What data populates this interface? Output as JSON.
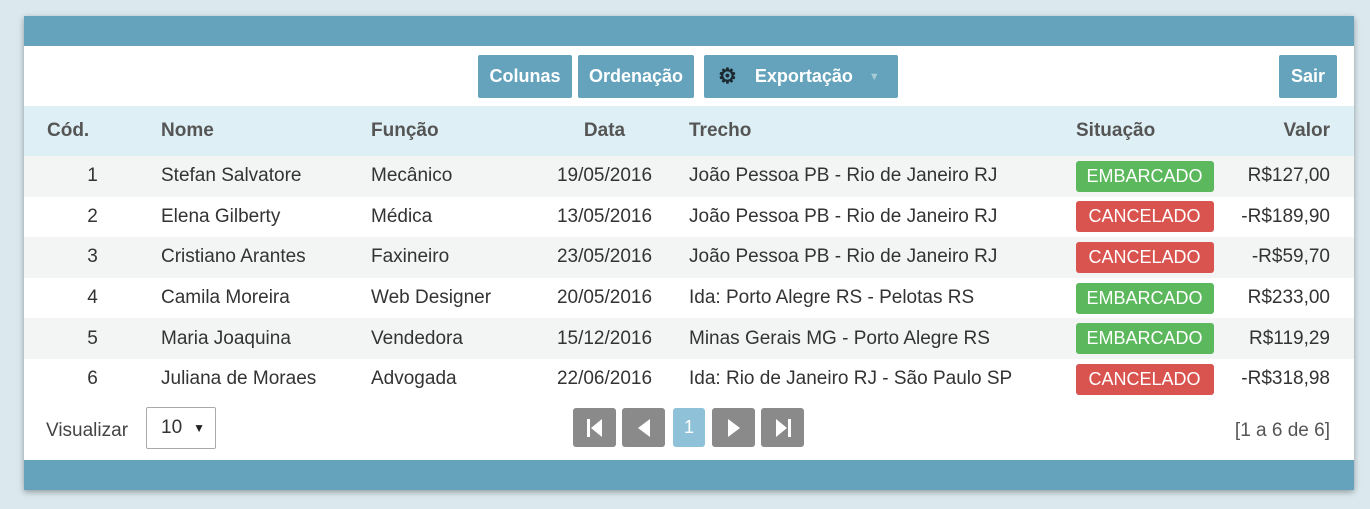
{
  "toolbar": {
    "columns_label": "Colunas",
    "sort_label": "Ordenação",
    "export_label": "Exportação",
    "exit_label": "Sair"
  },
  "table": {
    "headers": [
      "Cód.",
      "Nome",
      "Função",
      "Data",
      "Trecho",
      "Situação",
      "Valor"
    ],
    "rows": [
      {
        "cod": "1",
        "nome": "Stefan Salvatore",
        "funcao": "Mecânico",
        "data": "19/05/2016",
        "trecho": "João Pessoa PB - Rio de Janeiro RJ",
        "situacao": "EMBARCADO",
        "valor": "R$127,00"
      },
      {
        "cod": "2",
        "nome": "Elena Gilberty",
        "funcao": "Médica",
        "data": "13/05/2016",
        "trecho": "João Pessoa PB - Rio de Janeiro RJ",
        "situacao": "CANCELADO",
        "valor": "-R$189,90"
      },
      {
        "cod": "3",
        "nome": "Cristiano Arantes",
        "funcao": "Faxineiro",
        "data": "23/05/2016",
        "trecho": "João Pessoa PB - Rio de Janeiro RJ",
        "situacao": "CANCELADO",
        "valor": "-R$59,70"
      },
      {
        "cod": "4",
        "nome": "Camila Moreira",
        "funcao": "Web Designer",
        "data": "20/05/2016",
        "trecho": "Ida: Porto Alegre RS - Pelotas RS",
        "situacao": "EMBARCADO",
        "valor": "R$233,00"
      },
      {
        "cod": "5",
        "nome": "Maria Joaquina",
        "funcao": "Vendedora",
        "data": "15/12/2016",
        "trecho": "Minas Gerais MG - Porto Alegre RS",
        "situacao": "EMBARCADO",
        "valor": "R$119,29"
      },
      {
        "cod": "6",
        "nome": "Juliana de Moraes",
        "funcao": "Advogada",
        "data": "22/06/2016",
        "trecho": "Ida: Rio de Janeiro RJ - São Paulo SP",
        "situacao": "CANCELADO",
        "valor": "-R$318,98"
      }
    ]
  },
  "footer": {
    "view_label": "Visualizar",
    "page_size": "10",
    "current_page": "1",
    "record_count": "[1 a 6 de 6]"
  },
  "colors": {
    "band": "#64a3bb",
    "header_bg": "#def0f5",
    "status_ok": "#5cb85c",
    "status_cancel": "#d9534f"
  },
  "icons": [
    "gear-icon",
    "caret-down-icon",
    "first-page-icon",
    "prev-page-icon",
    "next-page-icon",
    "last-page-icon"
  ]
}
